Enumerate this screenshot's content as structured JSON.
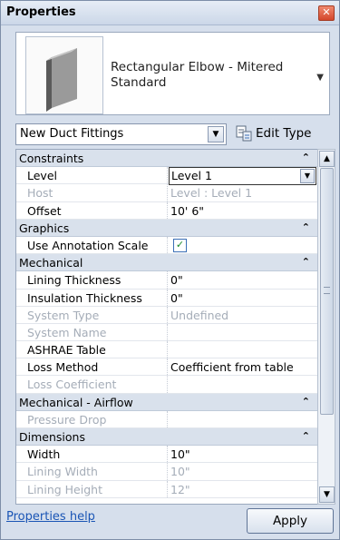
{
  "window": {
    "title": "Properties",
    "close_glyph": "✕"
  },
  "type_selector": {
    "name": "Rectangular Elbow - Mitered Standard",
    "dropdown_glyph": "▼"
  },
  "instance_filter": {
    "value": "New Duct Fittings",
    "dropdown_glyph": "▼"
  },
  "edit_type": {
    "label": "Edit Type",
    "icon": "edit-type-icon"
  },
  "groups": {
    "constraints": {
      "label": "Constraints",
      "collapse": "⌃"
    },
    "graphics": {
      "label": "Graphics",
      "collapse": "⌃"
    },
    "mechanical": {
      "label": "Mechanical",
      "collapse": "⌃"
    },
    "airflow": {
      "label": "Mechanical - Airflow",
      "collapse": "⌃"
    },
    "dimensions": {
      "label": "Dimensions",
      "collapse": "⌃"
    }
  },
  "props": {
    "level": {
      "key": "Level",
      "value": "Level 1"
    },
    "host": {
      "key": "Host",
      "value": "Level : Level 1"
    },
    "offset": {
      "key": "Offset",
      "value": "10' 6\""
    },
    "annotation": {
      "key": "Use Annotation Scale",
      "checked": true
    },
    "lining_thickness": {
      "key": "Lining Thickness",
      "value": "0\""
    },
    "insulation_thickness": {
      "key": "Insulation Thickness",
      "value": "0\""
    },
    "system_type": {
      "key": "System Type",
      "value": "Undefined"
    },
    "system_name": {
      "key": "System Name",
      "value": ""
    },
    "ashrae": {
      "key": "ASHRAE Table",
      "value": ""
    },
    "loss_method": {
      "key": "Loss Method",
      "value": "Coefficient from table"
    },
    "loss_coefficient": {
      "key": "Loss Coefficient",
      "value": ""
    },
    "pressure_drop": {
      "key": "Pressure Drop",
      "value": ""
    },
    "width": {
      "key": "Width",
      "value": "10\""
    },
    "lining_width": {
      "key": "Lining Width",
      "value": "10\""
    },
    "lining_height": {
      "key": "Lining Height",
      "value": "12\""
    }
  },
  "footer": {
    "help_link": "Properties help",
    "apply_label": "Apply"
  },
  "scrollbar": {
    "up": "▲",
    "down": "▼"
  }
}
